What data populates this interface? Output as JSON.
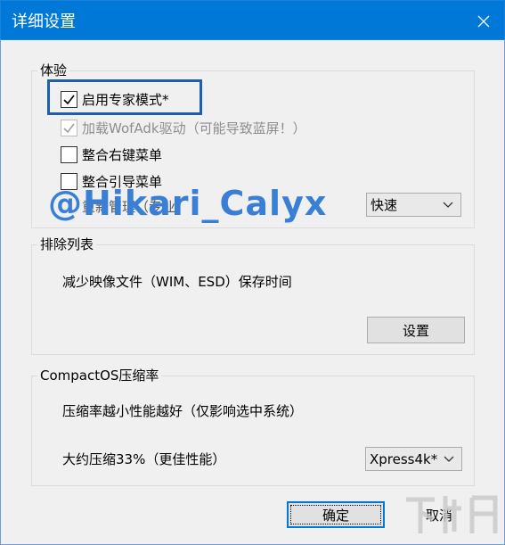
{
  "window": {
    "title": "详细设置",
    "close_icon": "close-icon",
    "accent_color": "#0078d7"
  },
  "experience": {
    "legend": "体验",
    "expert_mode": {
      "label": "启用专家模式*",
      "checked": true
    },
    "wofadk": {
      "label": "加载WofAdk驱动（可能导致蓝屏！）",
      "checked": true,
      "disabled": true
    },
    "context_menu": {
      "label": "整合右键菜单",
      "checked": false
    },
    "boot_menu": {
      "label": "整合引导菜单",
      "checked": false
    },
    "partial_label": "重新管理（专业）",
    "speed_combo": {
      "value": "快速"
    }
  },
  "exclusion": {
    "legend": "排除列表",
    "description": "减少映像文件（WIM、ESD）保存时间",
    "settings_button": "设置"
  },
  "compactos": {
    "legend": "CompactOS压缩率",
    "hint": "压缩率越小性能越好（仅影响选中系统）",
    "ratio_text": "大约压缩33%（更佳性能）",
    "algorithm_combo": {
      "value": "Xpress4k*"
    }
  },
  "footer": {
    "ok_button": "确定",
    "cancel_button": "取消"
  },
  "watermark": "@Hikari_Calyx",
  "corner_logo_text": "下载吧"
}
